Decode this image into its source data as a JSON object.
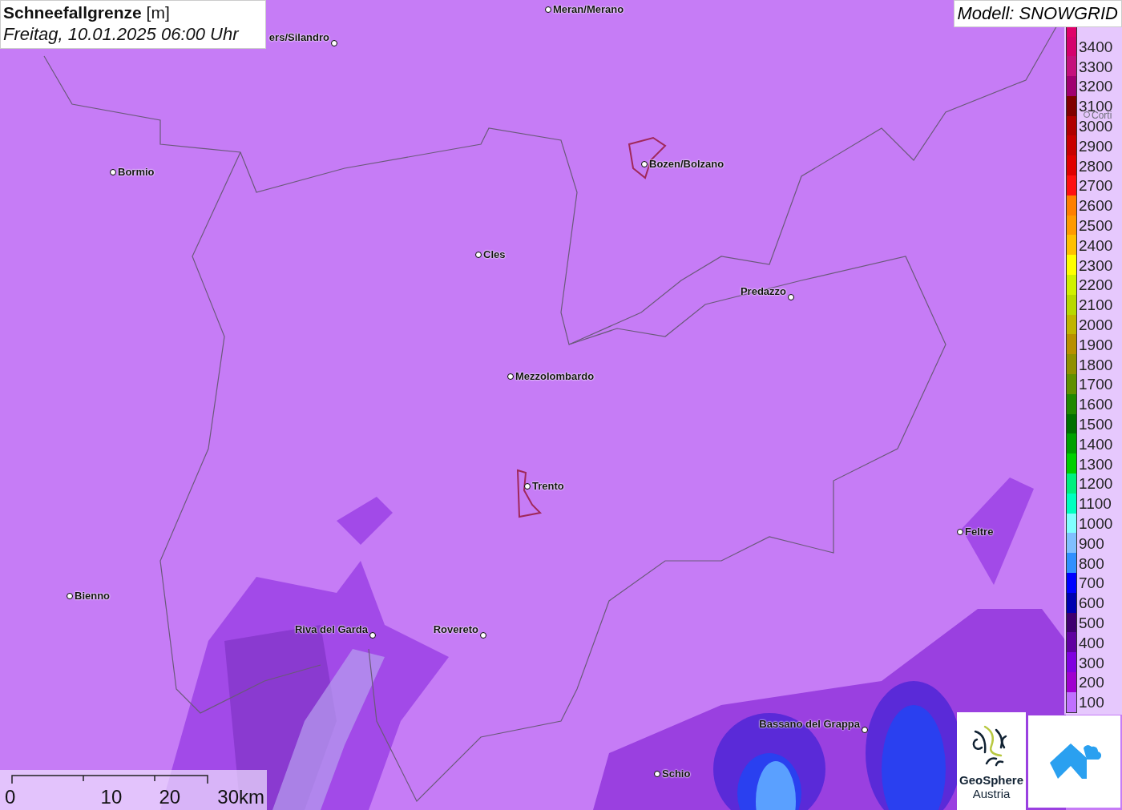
{
  "title": {
    "name": "Schneefallgrenze",
    "unit": "[m]",
    "time": "Freitag, 10.01.2025 06:00 Uhr"
  },
  "model": "Modell: SNOWGRID",
  "cities": [
    {
      "name": "Meran/Merano"
    },
    {
      "name": "ers/Silandro"
    },
    {
      "name": "Bormio"
    },
    {
      "name": "Bozen/Bolzano"
    },
    {
      "name": "Cles"
    },
    {
      "name": "Predazzo"
    },
    {
      "name": "Mezzolombardo"
    },
    {
      "name": "Trento"
    },
    {
      "name": "Feltre"
    },
    {
      "name": "Bienno"
    },
    {
      "name": "Riva del Garda"
    },
    {
      "name": "Rovereto"
    },
    {
      "name": "Bassano del Grappa"
    },
    {
      "name": "Schio"
    },
    {
      "name": "Corti"
    }
  ],
  "legend": [
    {
      "label": "3400",
      "color": "#d4006e"
    },
    {
      "label": "3300",
      "color": "#c4107c"
    },
    {
      "label": "3200",
      "color": "#a00070"
    },
    {
      "label": "3100",
      "color": "#800000"
    },
    {
      "label": "3000",
      "color": "#b00000"
    },
    {
      "label": "2900",
      "color": "#c80000"
    },
    {
      "label": "2800",
      "color": "#e00000"
    },
    {
      "label": "2700",
      "color": "#ff1010"
    },
    {
      "label": "2600",
      "color": "#ff7f00"
    },
    {
      "label": "2500",
      "color": "#ff9a00"
    },
    {
      "label": "2400",
      "color": "#ffc000"
    },
    {
      "label": "2300",
      "color": "#ffff00"
    },
    {
      "label": "2200",
      "color": "#d0f000"
    },
    {
      "label": "2100",
      "color": "#b8d800"
    },
    {
      "label": "2000",
      "color": "#c0b400"
    },
    {
      "label": "1900",
      "color": "#b89000"
    },
    {
      "label": "1800",
      "color": "#909000"
    },
    {
      "label": "1700",
      "color": "#609000"
    },
    {
      "label": "1600",
      "color": "#208800"
    },
    {
      "label": "1500",
      "color": "#007000"
    },
    {
      "label": "1400",
      "color": "#00a000"
    },
    {
      "label": "1300",
      "color": "#00d000"
    },
    {
      "label": "1200",
      "color": "#00f080"
    },
    {
      "label": "1100",
      "color": "#00ffc0"
    },
    {
      "label": "1000",
      "color": "#80ffff"
    },
    {
      "label": "900",
      "color": "#80c0ff"
    },
    {
      "label": "800",
      "color": "#3090ff"
    },
    {
      "label": "700",
      "color": "#0000ff"
    },
    {
      "label": "600",
      "color": "#0000b0"
    },
    {
      "label": "500",
      "color": "#400070"
    },
    {
      "label": "400",
      "color": "#6000a0"
    },
    {
      "label": "300",
      "color": "#8000e0"
    },
    {
      "label": "200",
      "color": "#a000d0"
    },
    {
      "label": "100",
      "color": "#c070ff"
    }
  ],
  "scale": {
    "ticks": [
      "0",
      "10",
      "20",
      "30km"
    ]
  },
  "logo": {
    "line1": "GeoSphere",
    "line2": "Austria"
  }
}
